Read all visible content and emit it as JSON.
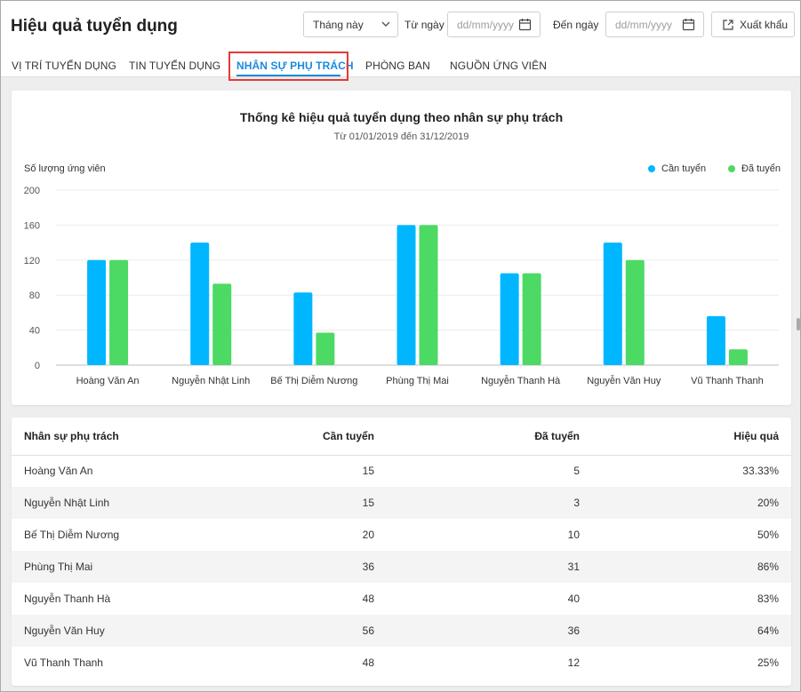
{
  "header": {
    "title": "Hiệu quả tuyển dụng",
    "period": "Tháng này",
    "from_label": "Từ ngày",
    "from_placeholder": "dd/mm/yyyy",
    "to_label": "Đến ngày",
    "to_placeholder": "dd/mm/yyyy",
    "export_label": "Xuất khẩu"
  },
  "tabs": [
    {
      "label": "VỊ TRÍ TUYỂN DỤNG",
      "active": false
    },
    {
      "label": "TIN TUYỂN DỤNG",
      "active": false
    },
    {
      "label": "NHÂN SỰ PHỤ TRÁCH",
      "active": true
    },
    {
      "label": "PHÒNG BAN",
      "active": false
    },
    {
      "label": "NGUỒN ỨNG VIÊN",
      "active": false
    }
  ],
  "colors": {
    "accent": "#1a8ae0",
    "series_need": "#00b7ff",
    "series_hired": "#4cd964",
    "highlight": "#e53935"
  },
  "chart_data": {
    "type": "bar",
    "title": "Thống kê hiệu quả tuyển dụng theo nhân sự phụ trách",
    "subtitle": "Từ 01/01/2019 đến 31/12/2019",
    "ylabel": "Số lượng ứng viên",
    "xlabel": "",
    "ylim": [
      0,
      200
    ],
    "yticks": [
      0,
      40,
      80,
      120,
      160,
      200
    ],
    "grid": true,
    "legend_position": "top-right",
    "categories": [
      "Hoàng Văn An",
      "Nguyễn Nhật Linh",
      "Bế Thị Diễm Nương",
      "Phùng Thị Mai",
      "Nguyễn Thanh Hà",
      "Nguyễn Văn Huy",
      "Vũ Thanh Thanh"
    ],
    "series": [
      {
        "name": "Cần tuyển",
        "color": "#00b7ff",
        "values": [
          120,
          140,
          83,
          160,
          105,
          140,
          56
        ]
      },
      {
        "name": "Đã tuyển",
        "color": "#4cd964",
        "values": [
          120,
          93,
          37,
          160,
          105,
          120,
          18
        ]
      }
    ]
  },
  "table": {
    "headers": [
      "Nhân sự phụ trách",
      "Cần tuyển",
      "Đã tuyển",
      "Hiệu quả"
    ],
    "rows": [
      [
        "Hoàng Văn An",
        "15",
        "5",
        "33.33%"
      ],
      [
        "Nguyễn Nhật Linh",
        "15",
        "3",
        "20%"
      ],
      [
        "Bế Thị Diễm Nương",
        "20",
        "10",
        "50%"
      ],
      [
        "Phùng Thị Mai",
        "36",
        "31",
        "86%"
      ],
      [
        "Nguyễn Thanh Hà",
        "48",
        "40",
        "83%"
      ],
      [
        "Nguyễn Văn Huy",
        "56",
        "36",
        "64%"
      ],
      [
        "Vũ Thanh Thanh",
        "48",
        "12",
        "25%"
      ]
    ]
  }
}
